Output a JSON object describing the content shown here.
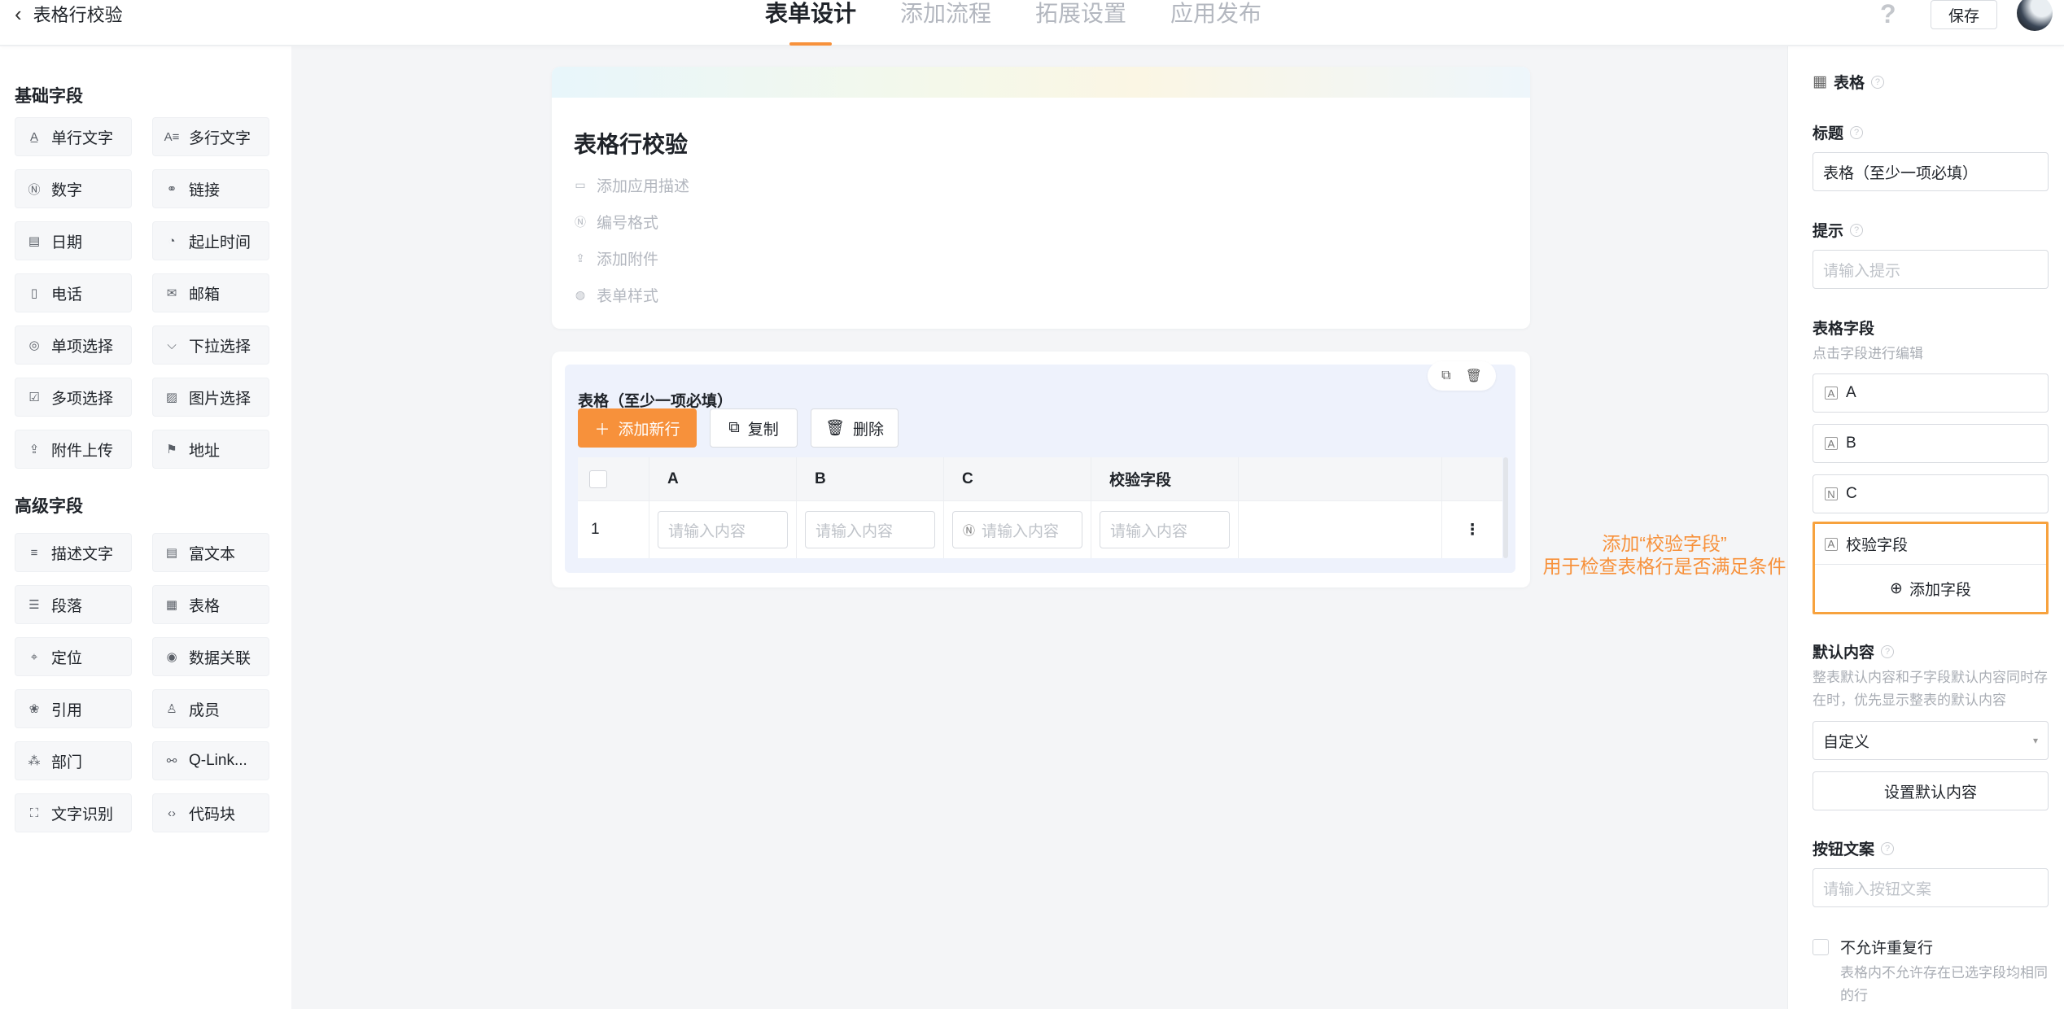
{
  "header": {
    "back_label": "表格行校验",
    "tabs": [
      {
        "label": "表单设计",
        "active": true
      },
      {
        "label": "添加流程",
        "active": false
      },
      {
        "label": "拓展设置",
        "active": false
      },
      {
        "label": "应用发布",
        "active": false
      }
    ],
    "help": "?",
    "save_label": "保存",
    "accent_color": "#f7913b"
  },
  "left_panel": {
    "basic_title": "基础字段",
    "basic_fields": [
      {
        "label": "单行文字",
        "icon": "text-line-icon"
      },
      {
        "label": "多行文字",
        "icon": "text-multi-icon"
      },
      {
        "label": "数字",
        "icon": "number-icon"
      },
      {
        "label": "链接",
        "icon": "link-icon"
      },
      {
        "label": "日期",
        "icon": "calendar-icon"
      },
      {
        "label": "起止时间",
        "icon": "time-range-icon"
      },
      {
        "label": "电话",
        "icon": "phone-icon"
      },
      {
        "label": "邮箱",
        "icon": "mail-icon"
      },
      {
        "label": "单项选择",
        "icon": "radio-icon"
      },
      {
        "label": "下拉选择",
        "icon": "dropdown-icon"
      },
      {
        "label": "多项选择",
        "icon": "checkbox-icon"
      },
      {
        "label": "图片选择",
        "icon": "image-icon"
      },
      {
        "label": "附件上传",
        "icon": "upload-icon"
      },
      {
        "label": "地址",
        "icon": "address-icon"
      }
    ],
    "advanced_title": "高级字段",
    "advanced_fields": [
      {
        "label": "描述文字",
        "icon": "description-icon"
      },
      {
        "label": "富文本",
        "icon": "rich-text-icon"
      },
      {
        "label": "段落",
        "icon": "paragraph-icon"
      },
      {
        "label": "表格",
        "icon": "table-icon"
      },
      {
        "label": "定位",
        "icon": "location-icon"
      },
      {
        "label": "数据关联",
        "icon": "data-link-icon"
      },
      {
        "label": "引用",
        "icon": "reference-icon"
      },
      {
        "label": "成员",
        "icon": "member-icon"
      },
      {
        "label": "部门",
        "icon": "department-icon"
      },
      {
        "label": "Q-Link...",
        "icon": "qlink-icon"
      },
      {
        "label": "文字识别",
        "icon": "ocr-icon"
      },
      {
        "label": "代码块",
        "icon": "code-icon"
      }
    ]
  },
  "form": {
    "title": "表格行校验",
    "options": [
      {
        "label": "添加应用描述",
        "icon": "comment-icon"
      },
      {
        "label": "编号格式",
        "icon": "number-format-icon"
      },
      {
        "label": "添加附件",
        "icon": "upload-icon"
      },
      {
        "label": "表单样式",
        "icon": "palette-icon"
      }
    ]
  },
  "table_widget": {
    "title": "表格（至少一项必填）",
    "add_row_label": "添加新行",
    "copy_label": "复制",
    "delete_label": "删除",
    "columns": [
      "A",
      "B",
      "C",
      "校验字段"
    ],
    "rows": [
      {
        "index": "1",
        "placeholder": "请输入内容"
      }
    ],
    "more": "⋮"
  },
  "annotation": {
    "line1": "添加“校验字段”",
    "line2": "用于检查表格行是否满足条件"
  },
  "right_panel": {
    "header": "表格",
    "title_label": "标题",
    "title_value": "表格（至少一项必填）",
    "hint_label": "提示",
    "hint_placeholder": "请输入提示",
    "fields_label": "表格字段",
    "fields_hint": "点击字段进行编辑",
    "fields": [
      "A",
      "B",
      "C"
    ],
    "highlight_field": "校验字段",
    "add_field_label": "添加字段",
    "default_label": "默认内容",
    "default_hint": "整表默认内容和子字段默认内容同时存在时，优先显示整表的默认内容",
    "default_select": "自定义",
    "set_default_label": "设置默认内容",
    "button_text_label": "按钮文案",
    "button_text_placeholder": "请输入按钮文案",
    "no_dup_label": "不允许重复行",
    "no_dup_hint": "表格内不允许存在已选字段均相同的行"
  }
}
